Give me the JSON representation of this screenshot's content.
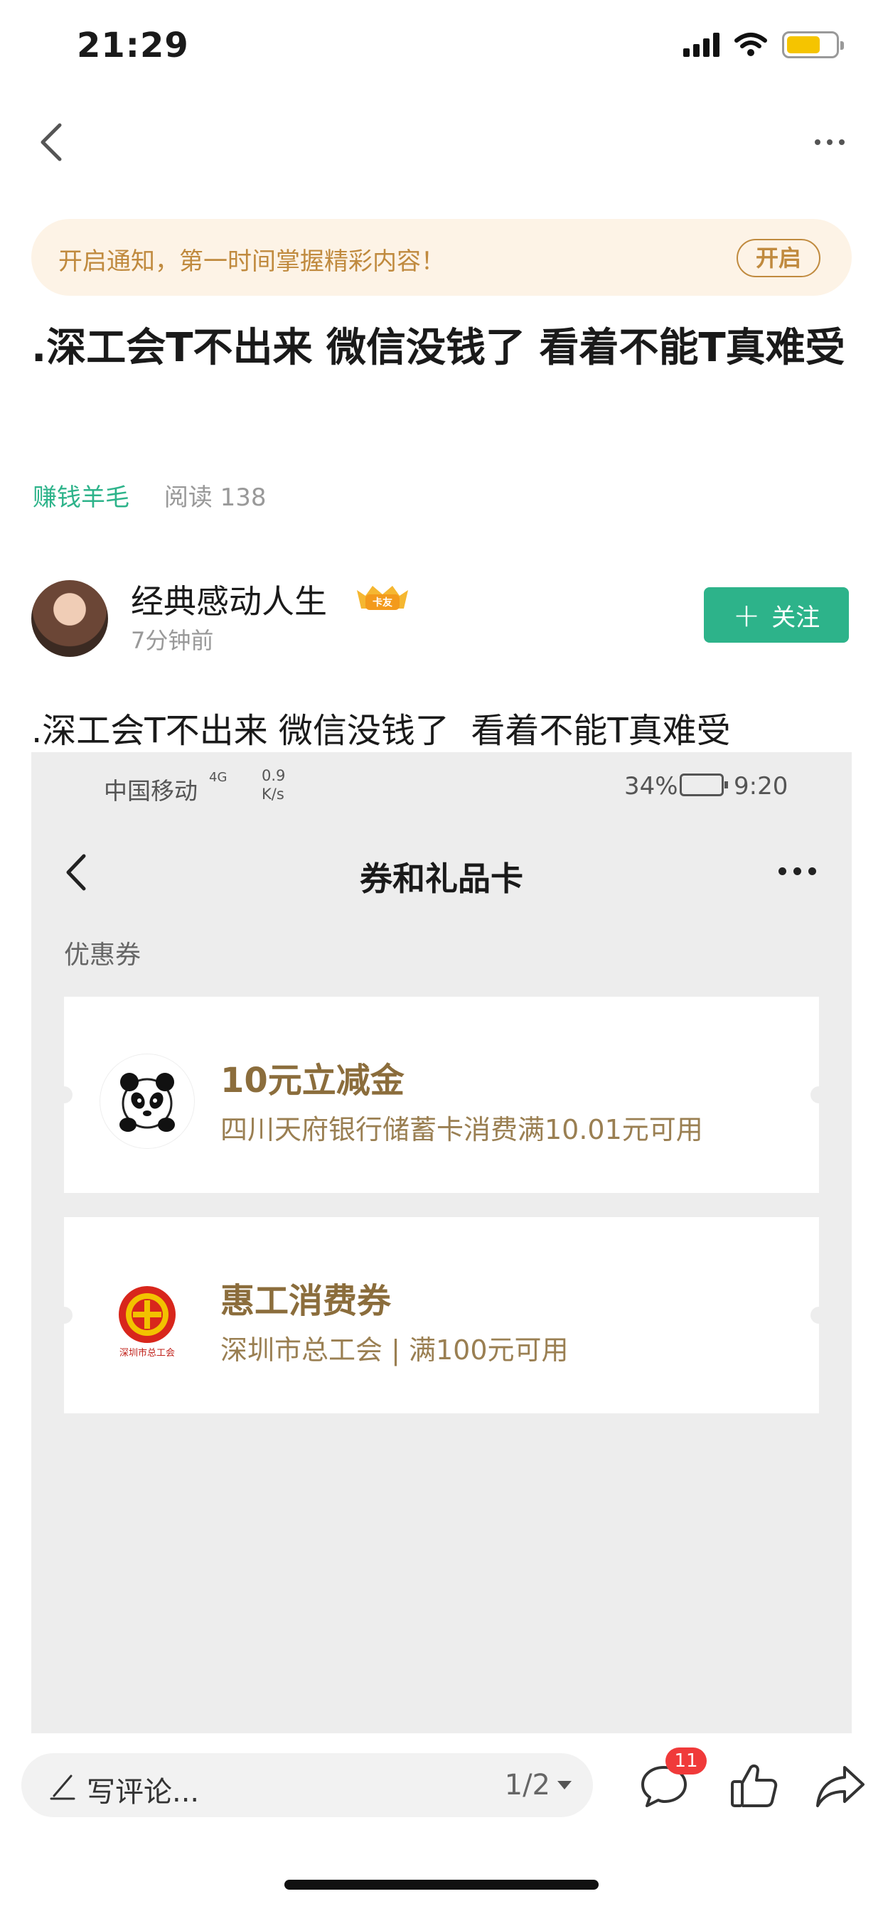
{
  "status_bar": {
    "time": "21:29"
  },
  "notify": {
    "text": "开启通知，第一时间掌握精彩内容！",
    "button": "开启"
  },
  "article": {
    "title": ".深工会T不出来 微信没钱了 看着不能T真难受",
    "category": "赚钱羊毛",
    "reads": "阅读 138",
    "body": ".深工会T不出来 微信没钱了  看着不能T真难受"
  },
  "author": {
    "name": "经典感动人生",
    "badge": "卡友",
    "time": "7分钟前",
    "follow_label": "关注"
  },
  "screenshot": {
    "carrier": "中国移动",
    "net": "4G",
    "speed_value": "0.9",
    "speed_unit": "K/s",
    "battery_pct": "34%",
    "clock": "9:20",
    "title": "券和礼品卡",
    "section": "优惠券",
    "coupons": [
      {
        "name": "10元立减金",
        "desc": "四川天府银行储蓄卡消费满10.01元可用",
        "logo": "panda-logo"
      },
      {
        "name": "惠工消费券",
        "desc": "深圳市总工会 | 满100元可用",
        "logo": "union-logo",
        "logo_text": "深圳市总工会"
      }
    ]
  },
  "toolbar": {
    "comment_placeholder": "写评论...",
    "page_indicator": "1/2",
    "comment_count": "11"
  },
  "colors": {
    "accent": "#2db38a",
    "notify_text": "#c08a3e",
    "coupon_title": "#8b6d3c",
    "badge_red": "#f03a3a"
  }
}
